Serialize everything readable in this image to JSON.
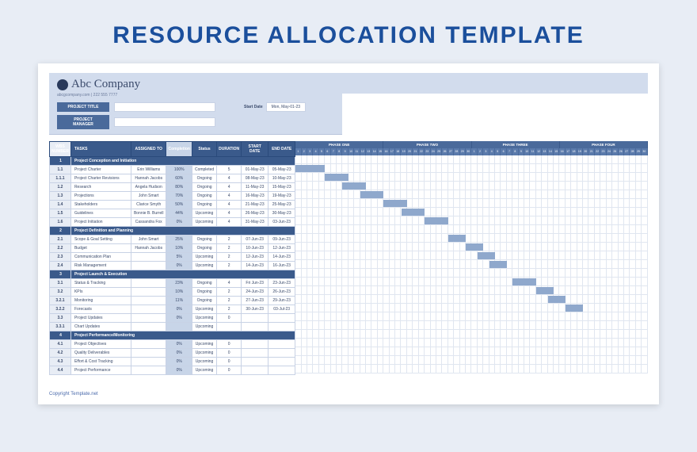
{
  "page_title": "RESOURCE ALLOCATION TEMPLATE",
  "company": {
    "name": "Abc Company",
    "sub": "abcgcompany.com | 222 555 7777"
  },
  "meta": {
    "project_title_label": "PROJECT TITLE",
    "project_manager_label": "PROJECT MANAGER",
    "start_date_label": "Start Date",
    "start_date_value": "Mon, May-01-23"
  },
  "columns": {
    "wbs": "WBS NUMBER",
    "tasks": "TASKS",
    "assigned": "ASSIGNED TO",
    "completion": "Completion",
    "status": "Status",
    "duration": "DURATION",
    "start": "START DATE",
    "end": "END DATE"
  },
  "phases": [
    "PHASE ONE",
    "PHASE TWO",
    "PHASE THREE",
    "PHASE FOUR"
  ],
  "sections": [
    {
      "wbs": "1",
      "title": "Project Conception and Initiation",
      "rows": [
        {
          "wbs": "1.1",
          "task": "Project Charter",
          "assigned": "Erin Williams",
          "comp": "100%",
          "status": "Completed",
          "dur": "5",
          "start": "01-May-23",
          "end": "05-May-23",
          "bar": [
            0,
            5
          ]
        },
        {
          "wbs": "1.1.1",
          "task": "Project Charter Revisions",
          "assigned": "Hannah Jacobs",
          "comp": "60%",
          "status": "Ongoing",
          "dur": "4",
          "start": "08-May-23",
          "end": "10-May-23",
          "bar": [
            5,
            4
          ]
        },
        {
          "wbs": "1.2",
          "task": "Research",
          "assigned": "Angela Hudson",
          "comp": "80%",
          "status": "Ongoing",
          "dur": "4",
          "start": "11-May-23",
          "end": "15-May-23",
          "bar": [
            8,
            4
          ]
        },
        {
          "wbs": "1.3",
          "task": "Projections",
          "assigned": "John Smart",
          "comp": "70%",
          "status": "Ongoing",
          "dur": "4",
          "start": "16-May-23",
          "end": "19-May-23",
          "bar": [
            11,
            4
          ]
        },
        {
          "wbs": "1.4",
          "task": "Stakeholders",
          "assigned": "Clarice Smyth",
          "comp": "50%",
          "status": "Ongoing",
          "dur": "4",
          "start": "21-May-23",
          "end": "25-May-23",
          "bar": [
            15,
            4
          ]
        },
        {
          "wbs": "1.5",
          "task": "Guidelines",
          "assigned": "Bonnie B. Burrell",
          "comp": "44%",
          "status": "Upcoming",
          "dur": "4",
          "start": "26-May-23",
          "end": "30-May-23",
          "bar": [
            18,
            4
          ]
        },
        {
          "wbs": "1.6",
          "task": "Project Initiation",
          "assigned": "Cassandra Fox",
          "comp": "0%",
          "status": "Upcoming",
          "dur": "4",
          "start": "31-May-23",
          "end": "03-Jun-23",
          "bar": [
            22,
            4
          ]
        }
      ]
    },
    {
      "wbs": "2",
      "title": "Project Definition and Planning",
      "rows": [
        {
          "wbs": "2.1",
          "task": "Scope & Goal Setting",
          "assigned": "John Smart",
          "comp": "25%",
          "status": "Ongoing",
          "dur": "2",
          "start": "07-Jun-23",
          "end": "09-Jun-23",
          "bar": [
            26,
            3
          ]
        },
        {
          "wbs": "2.2",
          "task": "Budget",
          "assigned": "Hannah Jacobs",
          "comp": "10%",
          "status": "Ongoing",
          "dur": "2",
          "start": "10-Jun-23",
          "end": "12-Jun-23",
          "bar": [
            29,
            3
          ]
        },
        {
          "wbs": "2.3",
          "task": "Communication Plan",
          "assigned": "",
          "comp": "5%",
          "status": "Upcoming",
          "dur": "2",
          "start": "12-Jun-23",
          "end": "14-Jun-23",
          "bar": [
            31,
            3
          ]
        },
        {
          "wbs": "2.4",
          "task": "Risk Management",
          "assigned": "",
          "comp": "0%",
          "status": "Upcoming",
          "dur": "2",
          "start": "14-Jun-23",
          "end": "16-Jun-23",
          "bar": [
            33,
            3
          ]
        }
      ]
    },
    {
      "wbs": "3",
      "title": "Project Launch & Execution",
      "rows": [
        {
          "wbs": "3.1",
          "task": "Status & Tracking",
          "assigned": "",
          "comp": "23%",
          "status": "Ongoing",
          "dur": "4",
          "start": "Fri Jun-23",
          "end": "23-Jun-23",
          "bar": [
            37,
            4
          ]
        },
        {
          "wbs": "3.2",
          "task": "KPIs",
          "assigned": "",
          "comp": "10%",
          "status": "Ongoing",
          "dur": "2",
          "start": "24-Jun-23",
          "end": "26-Jun-23",
          "bar": [
            41,
            3
          ]
        },
        {
          "wbs": "3.2.1",
          "task": "Monitoring",
          "assigned": "",
          "comp": "11%",
          "status": "Ongoing",
          "dur": "2",
          "start": "27-Jun-23",
          "end": "29-Jun-23",
          "bar": [
            43,
            3
          ]
        },
        {
          "wbs": "3.2.2",
          "task": "Forecasts",
          "assigned": "",
          "comp": "0%",
          "status": "Upcoming",
          "dur": "2",
          "start": "30-Jun-23",
          "end": "03-Jul-23",
          "bar": [
            46,
            3
          ]
        },
        {
          "wbs": "3.3",
          "task": "Project Updates",
          "assigned": "",
          "comp": "0%",
          "status": "Upcoming",
          "dur": "0",
          "start": "",
          "end": "",
          "bar": null
        },
        {
          "wbs": "3.3.1",
          "task": "Chart Updates",
          "assigned": "",
          "comp": "",
          "status": "Upcoming",
          "dur": "",
          "start": "",
          "end": "",
          "bar": null
        }
      ]
    },
    {
      "wbs": "4",
      "title": "Project Performance/Monitoring",
      "rows": [
        {
          "wbs": "4.1",
          "task": "Project Objectives",
          "assigned": "",
          "comp": "0%",
          "status": "Upcoming",
          "dur": "0",
          "start": "",
          "end": "",
          "bar": null
        },
        {
          "wbs": "4.2",
          "task": "Quality Deliverables",
          "assigned": "",
          "comp": "0%",
          "status": "Upcoming",
          "dur": "0",
          "start": "",
          "end": "",
          "bar": null
        },
        {
          "wbs": "4.3",
          "task": "Effort & Cost Tracking",
          "assigned": "",
          "comp": "0%",
          "status": "Upcoming",
          "dur": "0",
          "start": "",
          "end": "",
          "bar": null
        },
        {
          "wbs": "4.4",
          "task": "Project Performance",
          "assigned": "",
          "comp": "0%",
          "status": "Upcoming",
          "dur": "0",
          "start": "",
          "end": "",
          "bar": null
        }
      ]
    }
  ],
  "footer": "Copyright Template.net",
  "gantt_days": 60
}
